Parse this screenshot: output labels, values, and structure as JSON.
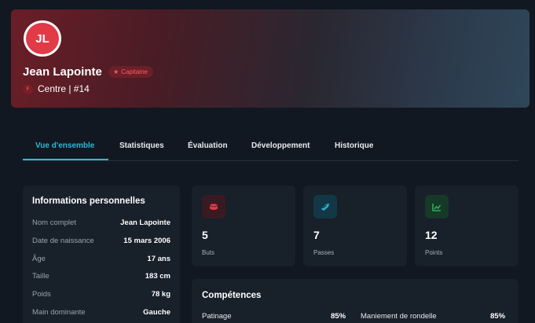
{
  "profile": {
    "initials": "JL",
    "name": "Jean Lapointe",
    "badge_label": "Capitaine",
    "position_letter": "F",
    "position_text": "Centre | #14"
  },
  "tabs": [
    {
      "label": "Vue d'ensemble"
    },
    {
      "label": "Statistiques"
    },
    {
      "label": "Évaluation"
    },
    {
      "label": "Développement"
    },
    {
      "label": "Historique"
    }
  ],
  "info": {
    "title": "Informations personnelles",
    "rows": [
      {
        "label": "Nom complet",
        "value": "Jean Lapointe"
      },
      {
        "label": "Date de naissance",
        "value": "15 mars 2006"
      },
      {
        "label": "Âge",
        "value": "17 ans"
      },
      {
        "label": "Taille",
        "value": "183 cm"
      },
      {
        "label": "Poids",
        "value": "78 kg"
      },
      {
        "label": "Main dominante",
        "value": "Gauche"
      }
    ]
  },
  "stats": [
    {
      "value": "5",
      "label": "Buts",
      "icon": "puck-icon",
      "color": "#e23a46",
      "bg": "#3a1a22"
    },
    {
      "value": "7",
      "label": "Passes",
      "icon": "passes-icon",
      "color": "#2fb7d6",
      "bg": "#123846"
    },
    {
      "value": "12",
      "label": "Points",
      "icon": "trend-icon",
      "color": "#2ec46a",
      "bg": "#163a27"
    }
  ],
  "skills": {
    "title": "Compétences",
    "items": [
      {
        "label": "Patinage",
        "value": "85%"
      },
      {
        "label": "Maniement de rondelle",
        "value": "85%"
      }
    ]
  },
  "colors": {
    "accent": "#2fb7d6",
    "captain": "#ff5a66",
    "avatar": "#e23a46"
  }
}
